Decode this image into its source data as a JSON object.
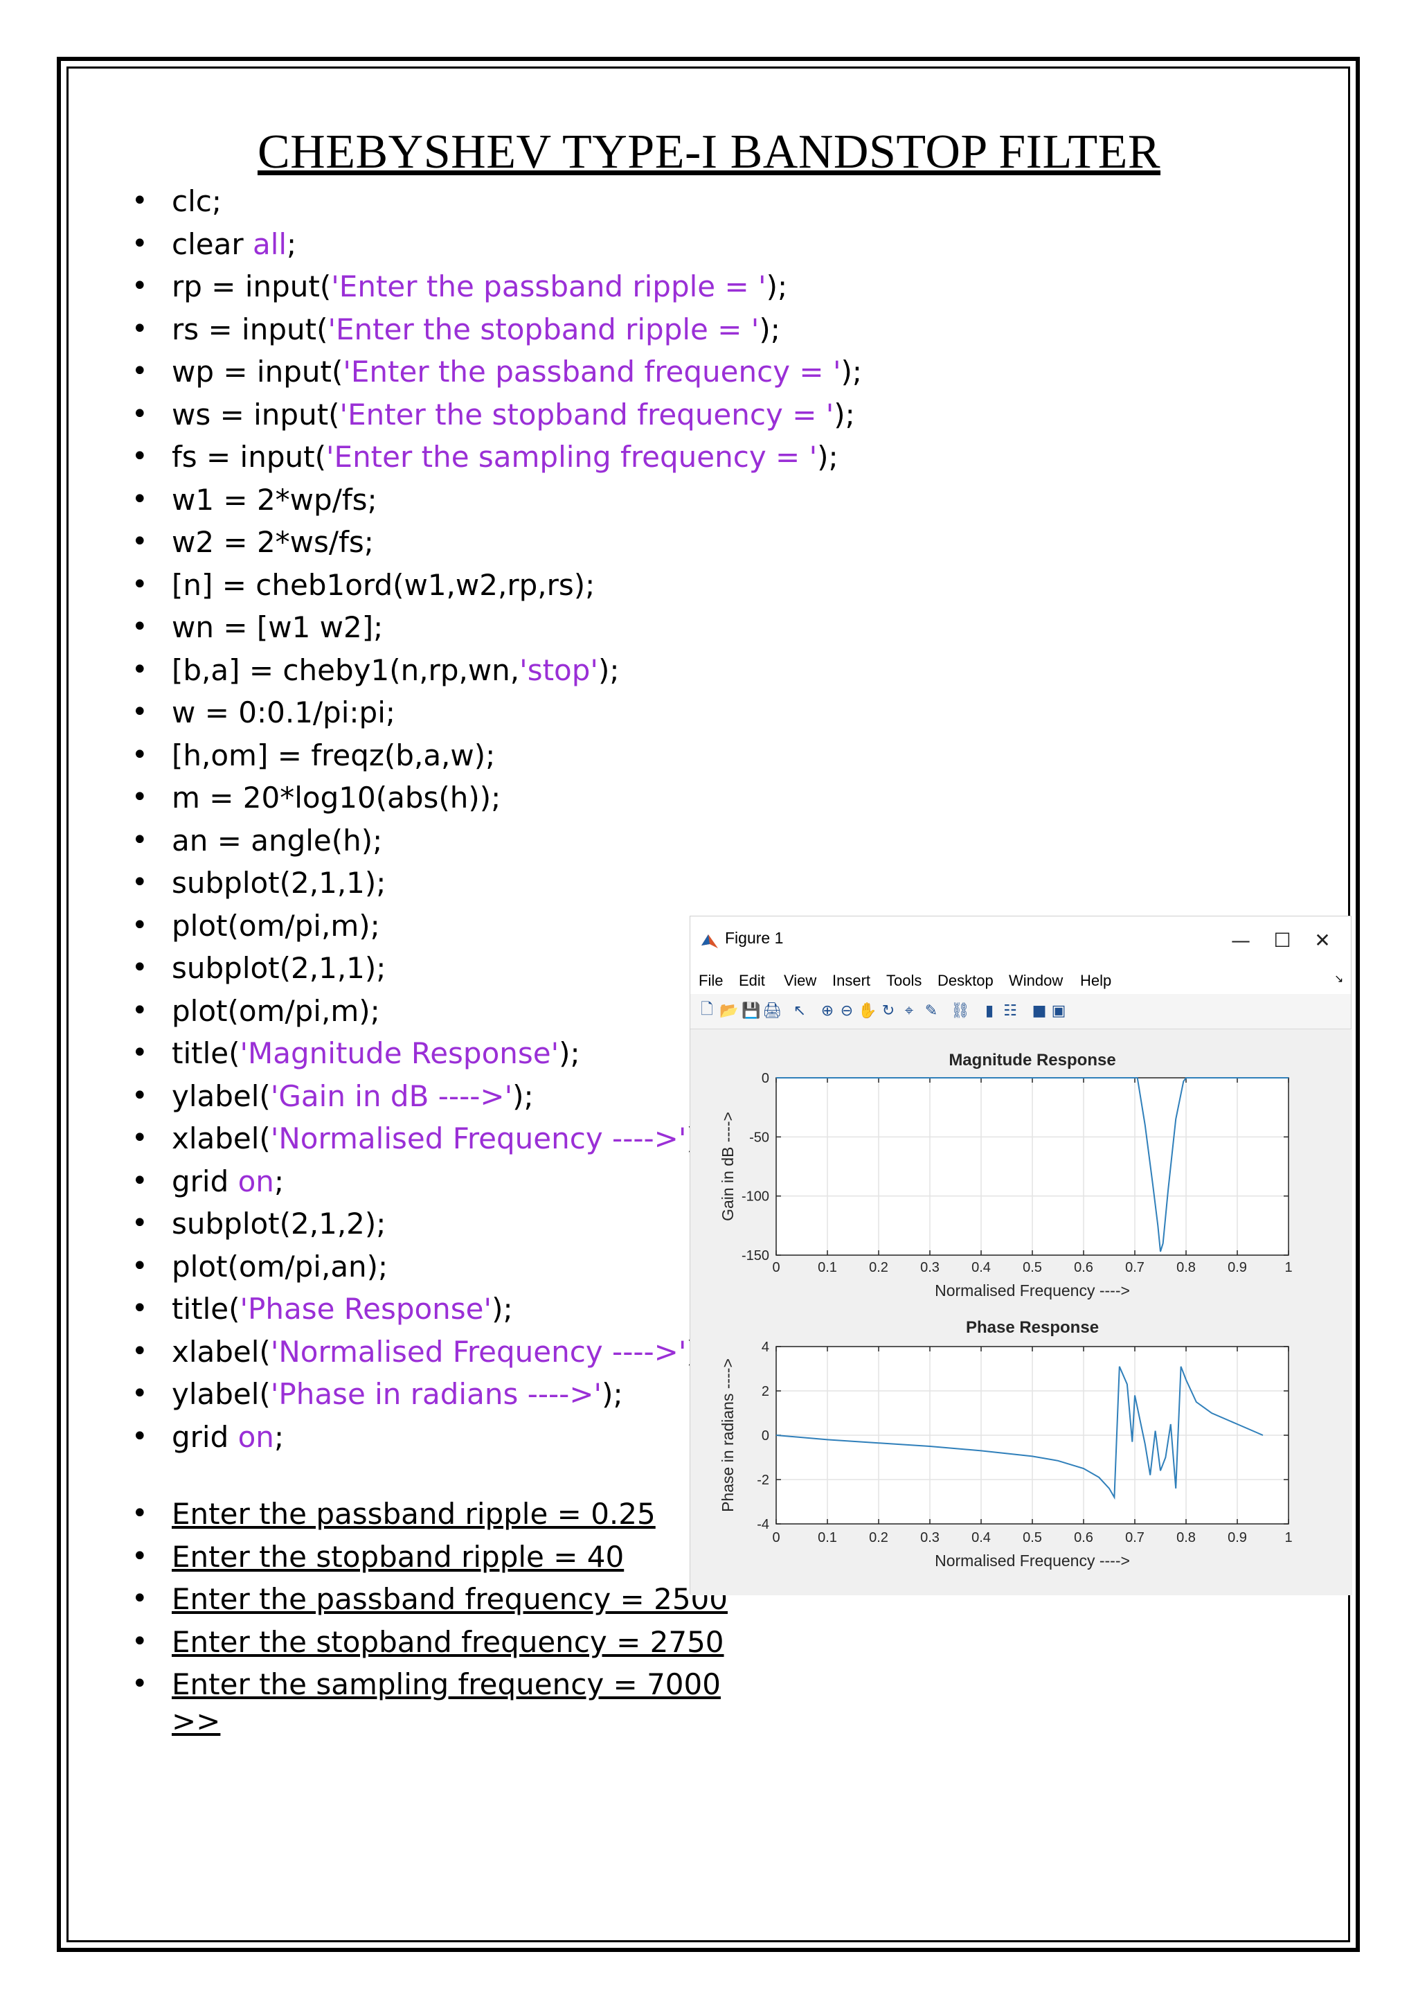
{
  "document": {
    "title": "CHEBYSHEV TYPE-I BANDSTOP FILTER",
    "code_lines": [
      [
        {
          "t": "clc;"
        }
      ],
      [
        {
          "t": "clear "
        },
        {
          "t": "all",
          "s": 1
        },
        {
          "t": ";"
        }
      ],
      [
        {
          "t": "rp = input("
        },
        {
          "t": "'Enter the passband ripple = '",
          "s": 1
        },
        {
          "t": ");"
        }
      ],
      [
        {
          "t": "rs = input("
        },
        {
          "t": "'Enter the stopband ripple = '",
          "s": 1
        },
        {
          "t": ");"
        }
      ],
      [
        {
          "t": "wp = input("
        },
        {
          "t": "'Enter the passband frequency = '",
          "s": 1
        },
        {
          "t": ");"
        }
      ],
      [
        {
          "t": "ws = input("
        },
        {
          "t": "'Enter the stopband frequency = '",
          "s": 1
        },
        {
          "t": ");"
        }
      ],
      [
        {
          "t": "fs = input("
        },
        {
          "t": "'Enter the sampling frequency = '",
          "s": 1
        },
        {
          "t": ");"
        }
      ],
      [
        {
          "t": "w1 = 2*wp/fs;"
        }
      ],
      [
        {
          "t": "w2 = 2*ws/fs;"
        }
      ],
      [
        {
          "t": "[n] = cheb1ord(w1,w2,rp,rs);"
        }
      ],
      [
        {
          "t": "wn = [w1 w2];"
        }
      ],
      [
        {
          "t": "[b,a] = cheby1(n,rp,wn,"
        },
        {
          "t": "'stop'",
          "s": 1
        },
        {
          "t": ");"
        }
      ],
      [
        {
          "t": "w = 0:0.1/pi:pi;"
        }
      ],
      [
        {
          "t": "[h,om] = freqz(b,a,w);"
        }
      ],
      [
        {
          "t": "m = 20*log10(abs(h));"
        }
      ],
      [
        {
          "t": "an = angle(h);"
        }
      ],
      [
        {
          "t": "subplot(2,1,1);"
        }
      ],
      [
        {
          "t": "plot(om/pi,m);"
        }
      ],
      [
        {
          "t": "subplot(2,1,1);"
        }
      ],
      [
        {
          "t": "plot(om/pi,m);"
        }
      ],
      [
        {
          "t": "title("
        },
        {
          "t": "'Magnitude Response'",
          "s": 1
        },
        {
          "t": ");"
        }
      ],
      [
        {
          "t": "ylabel("
        },
        {
          "t": "'Gain in dB ---->'",
          "s": 1
        },
        {
          "t": ");"
        }
      ],
      [
        {
          "t": "xlabel("
        },
        {
          "t": "'Normalised Frequency ---->'",
          "s": 1
        },
        {
          "t": ");"
        }
      ],
      [
        {
          "t": "grid "
        },
        {
          "t": "on",
          "s": 1
        },
        {
          "t": ";"
        }
      ],
      [
        {
          "t": "subplot(2,1,2);"
        }
      ],
      [
        {
          "t": "plot(om/pi,an);"
        }
      ],
      [
        {
          "t": "title("
        },
        {
          "t": "'Phase Response'",
          "s": 1
        },
        {
          "t": ");"
        }
      ],
      [
        {
          "t": "xlabel("
        },
        {
          "t": "'Normalised Frequency ---->'",
          "s": 1
        },
        {
          "t": ");"
        }
      ],
      [
        {
          "t": "ylabel("
        },
        {
          "t": "'Phase in radians ---->'",
          "s": 1
        },
        {
          "t": ");"
        }
      ],
      [
        {
          "t": "grid "
        },
        {
          "t": "on",
          "s": 1
        },
        {
          "t": ";"
        }
      ]
    ],
    "output_lines": [
      "Enter the passband ripple = 0.25",
      "Enter the stopband ripple = 40",
      "Enter the passband frequency = 2500",
      "Enter the stopband frequency = 2750",
      "Enter the sampling frequency = 7000"
    ],
    "prompt": ">>",
    "string_color": "#9a2fd6"
  },
  "figure_window": {
    "title": "Figure 1",
    "controls": {
      "minimize": "—",
      "maximize": "☐",
      "close": "✕"
    },
    "menu": [
      "File",
      "Edit",
      "View",
      "Insert",
      "Tools",
      "Desktop",
      "Window",
      "Help"
    ],
    "toolbar_icons": [
      "new-icon",
      "open-icon",
      "save-icon",
      "print-icon",
      "pointer-icon",
      "zoom-in-icon",
      "zoom-out-icon",
      "pan-icon",
      "rotate-icon",
      "data-cursor-icon",
      "brush-icon",
      "link-icon",
      "colorbar-icon",
      "legend-icon",
      "hide-plot-tools-icon",
      "show-plot-tools-icon"
    ],
    "line_color": "#2f7fba"
  },
  "chart_data": [
    {
      "type": "line",
      "title": "Magnitude Response",
      "xlabel": "Normalised Frequency ---->",
      "ylabel": "Gain in dB ---->",
      "xlim": [
        0,
        1
      ],
      "ylim": [
        -150,
        0
      ],
      "xticks": [
        "0",
        "0.1",
        "0.2",
        "0.3",
        "0.4",
        "0.5",
        "0.6",
        "0.7",
        "0.8",
        "0.9",
        "1"
      ],
      "yticks": [
        "0",
        "-50",
        "-100",
        "-150"
      ],
      "grid": true,
      "x": [
        0,
        0.1,
        0.2,
        0.3,
        0.4,
        0.5,
        0.6,
        0.7,
        0.705,
        0.72,
        0.735,
        0.745,
        0.75,
        0.755,
        0.765,
        0.78,
        0.795,
        0.8,
        0.82,
        0.9,
        1.0
      ],
      "y": [
        0,
        0,
        0,
        0,
        0,
        0,
        0,
        0,
        0,
        -40,
        -90,
        -125,
        -147,
        -140,
        -95,
        -35,
        -3,
        0,
        0,
        0,
        0
      ]
    },
    {
      "type": "line",
      "title": "Phase Response",
      "xlabel": "Normalised Frequency ---->",
      "ylabel": "Phase in radians ---->",
      "xlim": [
        0,
        1
      ],
      "ylim": [
        -4,
        4
      ],
      "xticks": [
        "0",
        "0.1",
        "0.2",
        "0.3",
        "0.4",
        "0.5",
        "0.6",
        "0.7",
        "0.8",
        "0.9",
        "1"
      ],
      "yticks": [
        "4",
        "2",
        "0",
        "-2",
        "-4"
      ],
      "grid": true,
      "x": [
        0,
        0.1,
        0.2,
        0.3,
        0.4,
        0.5,
        0.55,
        0.6,
        0.63,
        0.65,
        0.66,
        0.67,
        0.685,
        0.695,
        0.7,
        0.72,
        0.73,
        0.74,
        0.75,
        0.76,
        0.77,
        0.78,
        0.79,
        0.8,
        0.81,
        0.82,
        0.85,
        0.9,
        0.95,
        1.0
      ],
      "y": [
        0,
        -0.2,
        -0.35,
        -0.5,
        -0.7,
        -0.95,
        -1.15,
        -1.5,
        -1.9,
        -2.4,
        -2.8,
        3.1,
        2.3,
        -0.3,
        1.8,
        -0.4,
        -1.8,
        0.2,
        -1.6,
        -1.0,
        0.5,
        -2.4,
        3.1,
        2.5,
        2.0,
        1.5,
        1.0,
        0.5,
        0.0
      ]
    }
  ]
}
